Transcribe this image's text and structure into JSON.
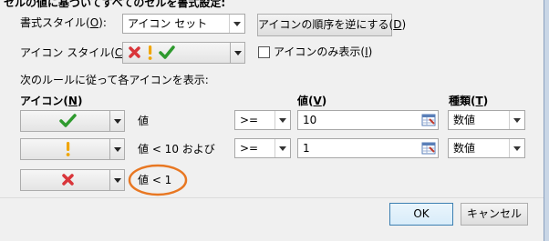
{
  "dialog": {
    "section_title": "セルの値に基づいてすべてのセルを書式設定:",
    "format_style": {
      "label": "書式スタイル(",
      "key": "O",
      "suffix": "):",
      "value": "アイコン セット"
    },
    "reverse_button": {
      "label": "アイコンの順序を逆にする(",
      "key": "D",
      "suffix": ")"
    },
    "icon_style": {
      "label": "アイコン スタイル(",
      "key": "C",
      "suffix": "):"
    },
    "icon_only": {
      "label": "アイコンのみ表示(",
      "key": "I",
      "suffix": ")",
      "checked": false
    },
    "rules_heading": "次のルールに従って各アイコンを表示:",
    "headers": {
      "icon": {
        "label": "アイコン(",
        "key": "N",
        "suffix": ")"
      },
      "value": {
        "label": "値(",
        "key": "V",
        "suffix": ")"
      },
      "type": {
        "label": "種類(",
        "key": "T",
        "suffix": ")"
      }
    },
    "rules": [
      {
        "icon": "green-check-icon",
        "condition": "値",
        "operator": ">=",
        "value": "10",
        "type": "数値"
      },
      {
        "icon": "yellow-exclamation-icon",
        "condition": "値 < 10 および",
        "operator": ">=",
        "value": "1",
        "type": "数値"
      },
      {
        "icon": "red-x-icon",
        "condition": "値 < 1"
      }
    ],
    "ok_label": "OK",
    "cancel_label": "キャンセル"
  },
  "colors": {
    "check": "#2e9a2e",
    "exclaim": "#f0a500",
    "cross": "#d9353a",
    "highlight": "#e87722"
  }
}
